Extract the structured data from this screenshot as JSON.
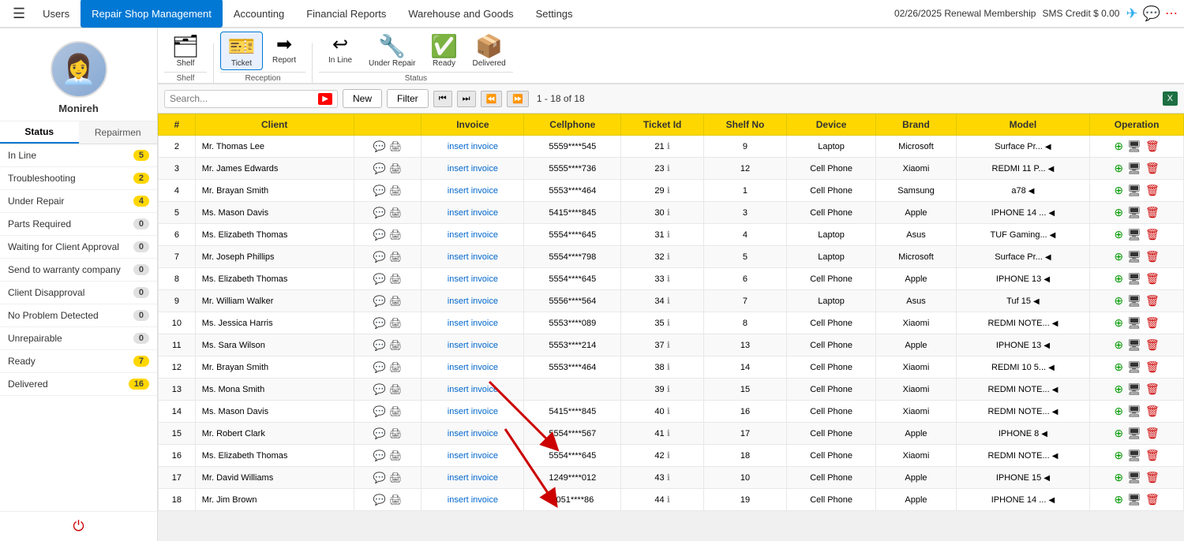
{
  "topNav": {
    "menuIcon": "☰",
    "items": [
      {
        "label": "Users",
        "active": false
      },
      {
        "label": "Repair Shop Management",
        "active": true
      },
      {
        "label": "Accounting",
        "active": false
      },
      {
        "label": "Financial Reports",
        "active": false
      },
      {
        "label": "Warehouse and Goods",
        "active": false
      },
      {
        "label": "Settings",
        "active": false
      }
    ],
    "renewal": "02/26/2025 Renewal Membership",
    "smsCredit": "SMS Credit $ 0.00",
    "telegramIcon": "✈",
    "whatsappIcon": "📱",
    "dotsIcon": "⋯"
  },
  "sidebar": {
    "avatarAlt": "Monireh",
    "userName": "Monireh",
    "tabs": [
      {
        "label": "Status",
        "active": true
      },
      {
        "label": "Repairmen",
        "active": false
      }
    ],
    "statusItems": [
      {
        "label": "In Line",
        "count": 5
      },
      {
        "label": "Troubleshooting",
        "count": 2
      },
      {
        "label": "Under Repair",
        "count": 4
      },
      {
        "label": "Parts Required",
        "count": 0
      },
      {
        "label": "Waiting for Client Approval",
        "count": 0
      },
      {
        "label": "Send to warranty company",
        "count": 0
      },
      {
        "label": "Client Disapproval",
        "count": 0
      },
      {
        "label": "No Problem Detected",
        "count": 0
      },
      {
        "label": "Unrepairable",
        "count": 0
      },
      {
        "label": "Ready",
        "count": 7
      },
      {
        "label": "Delivered",
        "count": 16
      }
    ]
  },
  "toolbar": {
    "shelfIcon": "🗂",
    "shelfLabel": "Shelf",
    "ticketIcon": "🎫",
    "ticketLabel": "Ticket",
    "reportIcon": "→",
    "reportLabel": "Report",
    "inLineIcon": "↩",
    "inLineLabel": "In Line",
    "underRepairIcon": "🔧",
    "underRepairLabel": "Under Repair",
    "readyIcon": "✅",
    "readyLabel": "Ready",
    "deliveredIcon": "📦",
    "deliveredLabel": "Delivered",
    "group1Label": "Shelf",
    "group2Label": "Reception",
    "group3Label": "Status"
  },
  "actionBar": {
    "searchPlaceholder": "Search...",
    "newLabel": "New",
    "filterLabel": "Filter",
    "pageInfo": "1 - 18 of 18"
  },
  "table": {
    "headers": [
      "#",
      "Client",
      "",
      "Invoice",
      "Cellphone",
      "Ticket Id",
      "Shelf No",
      "Device",
      "Brand",
      "Model",
      "Operation"
    ],
    "rows": [
      {
        "num": 2,
        "client": "Mr. Thomas Lee",
        "invoice": "insert invoice",
        "cellphone": "5559****545",
        "ticketId": 21,
        "shelfNo": 9,
        "device": "Laptop",
        "brand": "Microsoft",
        "model": "Surface Pr..."
      },
      {
        "num": 3,
        "client": "Mr. James Edwards",
        "invoice": "insert invoice",
        "cellphone": "5555****736",
        "ticketId": 23,
        "shelfNo": 12,
        "device": "Cell Phone",
        "brand": "Xiaomi",
        "model": "REDMI 11 P..."
      },
      {
        "num": 4,
        "client": "Mr. Brayan Smith",
        "invoice": "insert invoice",
        "cellphone": "5553****464",
        "ticketId": 29,
        "shelfNo": 1,
        "device": "Cell Phone",
        "brand": "Samsung",
        "model": "a78"
      },
      {
        "num": 5,
        "client": "Ms. Mason Davis",
        "invoice": "insert invoice",
        "cellphone": "5415****845",
        "ticketId": 30,
        "shelfNo": 3,
        "device": "Cell Phone",
        "brand": "Apple",
        "model": "IPHONE 14 ..."
      },
      {
        "num": 6,
        "client": "Ms. Elizabeth Thomas",
        "invoice": "insert invoice",
        "cellphone": "5554****645",
        "ticketId": 31,
        "shelfNo": 4,
        "device": "Laptop",
        "brand": "Asus",
        "model": "TUF Gaming..."
      },
      {
        "num": 7,
        "client": "Mr. Joseph Phillips",
        "invoice": "insert invoice",
        "cellphone": "5554****798",
        "ticketId": 32,
        "shelfNo": 5,
        "device": "Laptop",
        "brand": "Microsoft",
        "model": "Surface Pr..."
      },
      {
        "num": 8,
        "client": "Ms. Elizabeth Thomas",
        "invoice": "insert invoice",
        "cellphone": "5554****645",
        "ticketId": 33,
        "shelfNo": 6,
        "device": "Cell Phone",
        "brand": "Apple",
        "model": "IPHONE 13"
      },
      {
        "num": 9,
        "client": "Mr. William Walker",
        "invoice": "insert invoice",
        "cellphone": "5556****564",
        "ticketId": 34,
        "shelfNo": 7,
        "device": "Laptop",
        "brand": "Asus",
        "model": "Tuf 15"
      },
      {
        "num": 10,
        "client": "Ms. Jessica Harris",
        "invoice": "insert invoice",
        "cellphone": "5553****089",
        "ticketId": 35,
        "shelfNo": 8,
        "device": "Cell Phone",
        "brand": "Xiaomi",
        "model": "REDMI NOTE..."
      },
      {
        "num": 11,
        "client": "Ms. Sara Wilson",
        "invoice": "insert invoice",
        "cellphone": "5553****214",
        "ticketId": 37,
        "shelfNo": 13,
        "device": "Cell Phone",
        "brand": "Apple",
        "model": "IPHONE 13"
      },
      {
        "num": 12,
        "client": "Mr. Brayan Smith",
        "invoice": "insert invoice",
        "cellphone": "5553****464",
        "ticketId": 38,
        "shelfNo": 14,
        "device": "Cell Phone",
        "brand": "Xiaomi",
        "model": "REDMI 10 5..."
      },
      {
        "num": 13,
        "client": "Ms. Mona Smith",
        "invoice": "insert invoice",
        "cellphone": "",
        "ticketId": 39,
        "shelfNo": 15,
        "device": "Cell Phone",
        "brand": "Xiaomi",
        "model": "REDMI NOTE..."
      },
      {
        "num": 14,
        "client": "Ms. Mason Davis",
        "invoice": "insert invoice",
        "cellphone": "5415****845",
        "ticketId": 40,
        "shelfNo": 16,
        "device": "Cell Phone",
        "brand": "Xiaomi",
        "model": "REDMI NOTE..."
      },
      {
        "num": 15,
        "client": "Mr. Robert Clark",
        "invoice": "insert invoice",
        "cellphone": "5554****567",
        "ticketId": 41,
        "shelfNo": 17,
        "device": "Cell Phone",
        "brand": "Apple",
        "model": "IPHONE 8"
      },
      {
        "num": 16,
        "client": "Ms. Elizabeth Thomas",
        "invoice": "insert invoice",
        "cellphone": "5554****645",
        "ticketId": 42,
        "shelfNo": 18,
        "device": "Cell Phone",
        "brand": "Xiaomi",
        "model": "REDMI NOTE..."
      },
      {
        "num": 17,
        "client": "Mr. David Williams",
        "invoice": "insert invoice",
        "cellphone": "1249****012",
        "ticketId": 43,
        "shelfNo": 10,
        "device": "Cell Phone",
        "brand": "Apple",
        "model": "IPHONE 15"
      },
      {
        "num": 18,
        "client": "Mr. Jim Brown",
        "invoice": "insert invoice",
        "cellphone": "5051****86",
        "ticketId": 44,
        "shelfNo": 19,
        "device": "Cell Phone",
        "brand": "Apple",
        "model": "IPHONE 14 ..."
      }
    ]
  }
}
